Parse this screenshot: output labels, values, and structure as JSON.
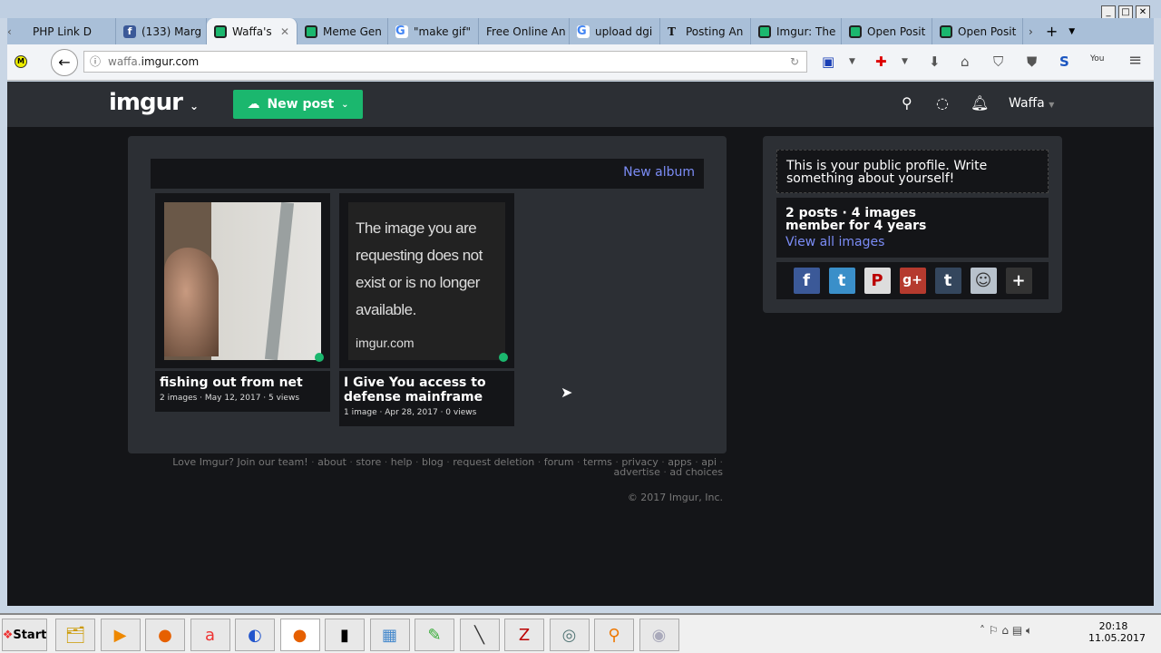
{
  "browser": {
    "tabs": [
      {
        "label": "PHP Link D",
        "icon": "php-icon"
      },
      {
        "label": "(133) Marg",
        "icon": "facebook-icon"
      },
      {
        "label": "Waffa's",
        "icon": "imgur-icon",
        "active": true
      },
      {
        "label": "Meme Gen",
        "icon": "imgur-icon"
      },
      {
        "label": "\"make gif\"",
        "icon": "google-icon"
      },
      {
        "label": "Free Online An",
        "icon": ""
      },
      {
        "label": "upload dgi",
        "icon": "google-icon"
      },
      {
        "label": "Posting An",
        "icon": "nyt-icon"
      },
      {
        "label": "Imgur: The",
        "icon": "imgur-icon"
      },
      {
        "label": "Open Posit",
        "icon": "imgur-icon"
      },
      {
        "label": "Open Posit",
        "icon": "imgur-icon"
      }
    ],
    "url_prefix": "waffa.",
    "url_domain": "imgur.com"
  },
  "header": {
    "logo": "imgur",
    "new_post": "New post",
    "user": "Waffa"
  },
  "main": {
    "new_album": "New album",
    "posts": [
      {
        "title": "fishing out from net",
        "meta": "2 images · May 12, 2017 · 5 views"
      },
      {
        "title": "I Give You access to defense mainframe",
        "meta": "1 image · Apr 28, 2017 · 0 views",
        "image_text": "The image you are requesting does not exist or is no longer available.",
        "image_caption": "imgur.com"
      }
    ]
  },
  "footer": {
    "links": [
      "Love Imgur? Join our team!",
      "about",
      "store",
      "help",
      "blog",
      "request deletion",
      "forum",
      "terms",
      "privacy",
      "apps",
      "api",
      "advertise",
      "ad choices"
    ],
    "copyright": "© 2017 Imgur, Inc."
  },
  "sidebar": {
    "bio": "This is your public profile. Write something about yourself!",
    "posts": "2 posts",
    "sep": " · ",
    "images": "4 images",
    "member": "member for 4 years",
    "view_all": "View all images",
    "share": [
      "facebook",
      "twitter",
      "pinterest",
      "google-plus",
      "tumblr",
      "reddit",
      "more"
    ]
  },
  "taskbar": {
    "start": "Start",
    "time": "20:18",
    "date": "11.05.2017"
  }
}
